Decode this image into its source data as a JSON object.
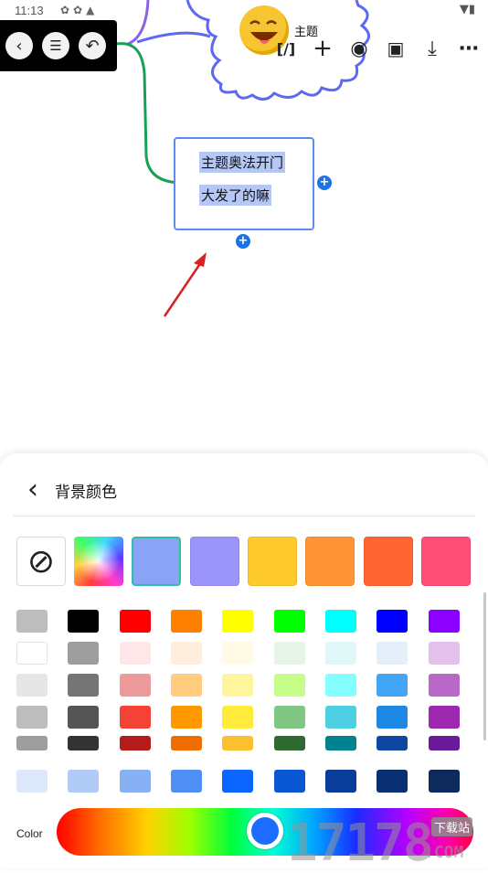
{
  "status_bar": {
    "time": "11:13",
    "icons": [
      "settings-icon",
      "settings-icon",
      "warning-icon"
    ],
    "right_icons": [
      "wifi-icon",
      "battery-icon"
    ]
  },
  "nav_peek_text": "内 主题",
  "toolbar": {
    "format_glyph": "[/]",
    "add_glyph": "+",
    "palette_glyph": "◉",
    "save_glyph": "▣",
    "download_glyph": "⤓",
    "more_glyph": "⋯"
  },
  "mindmap": {
    "root_title": "主题",
    "topic": {
      "line1": "主题奥法开门",
      "line2": "大发了的嘛"
    },
    "plus_symbol": "+"
  },
  "sheet": {
    "back_glyph": "‹",
    "title": "背景颜色",
    "no_color_glyph": "⊘",
    "presets": [
      "#8aa3f5",
      "#9b94fa",
      "#ffca2b",
      "#ff9537",
      "#ff6533",
      "#ff4e78"
    ],
    "swatch_rows": [
      [
        "#bdbdbd",
        "#000000",
        "#ff0000",
        "#ff7f00",
        "#ffff00",
        "#00ff00",
        "#00ffff",
        "#0000ff",
        "#8b00ff"
      ],
      [
        "#ffffff",
        "#9e9e9e",
        "#ffe6e8",
        "#ffeede",
        "#fffbe6",
        "#e7f4e8",
        "#e0f7f7",
        "#e4effa",
        "#e3c1ea"
      ],
      [
        "#e6e6e6",
        "#757575",
        "#ef9a9a",
        "#ffcc80",
        "#fff59d",
        "#c5ff8a",
        "#84ffff",
        "#42a5f5",
        "#ba68c8"
      ],
      [
        "#bdbdbd",
        "#555555",
        "#f44336",
        "#ff9800",
        "#ffeb3b",
        "#81c784",
        "#4dd0e1",
        "#1e88e5",
        "#9c27b0"
      ],
      [
        "#9e9e9e",
        "#333333",
        "#b71c1c",
        "#ef6c00",
        "#fbc02d",
        "#2e6b2e",
        "#00838f",
        "#0d47a1",
        "#6a1b9a"
      ],
      [
        "#dde8fb",
        "#b1cbf7",
        "#87b0f5",
        "#4f8ff5",
        "#0a66ff",
        "#0a57d4",
        "#0a3d99",
        "#0b2f73",
        "#0e2a5c"
      ]
    ],
    "color_label": "Color"
  },
  "watermark": {
    "text": "17178",
    "tag": "下载站",
    "com": ".COM"
  }
}
